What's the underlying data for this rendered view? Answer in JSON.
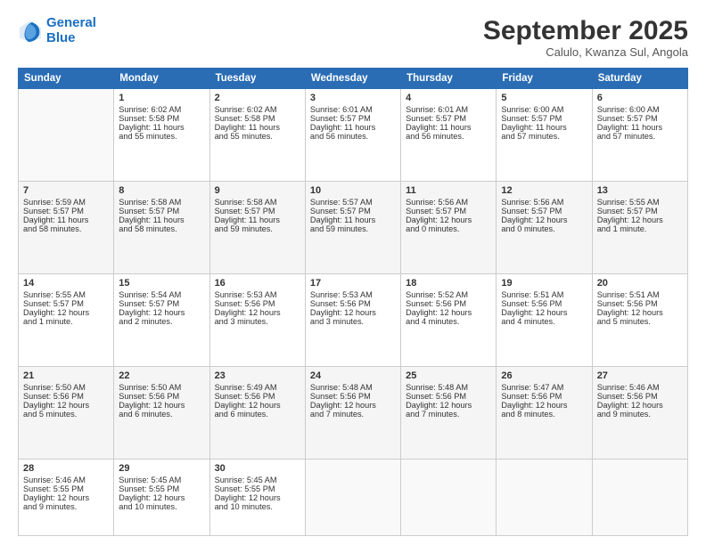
{
  "logo": {
    "line1": "General",
    "line2": "Blue"
  },
  "title": "September 2025",
  "subtitle": "Calulo, Kwanza Sul, Angola",
  "days": [
    "Sunday",
    "Monday",
    "Tuesday",
    "Wednesday",
    "Thursday",
    "Friday",
    "Saturday"
  ],
  "weeks": [
    [
      {
        "num": "",
        "content": ""
      },
      {
        "num": "1",
        "content": "Sunrise: 6:02 AM\nSunset: 5:58 PM\nDaylight: 11 hours\nand 55 minutes."
      },
      {
        "num": "2",
        "content": "Sunrise: 6:02 AM\nSunset: 5:58 PM\nDaylight: 11 hours\nand 55 minutes."
      },
      {
        "num": "3",
        "content": "Sunrise: 6:01 AM\nSunset: 5:57 PM\nDaylight: 11 hours\nand 56 minutes."
      },
      {
        "num": "4",
        "content": "Sunrise: 6:01 AM\nSunset: 5:57 PM\nDaylight: 11 hours\nand 56 minutes."
      },
      {
        "num": "5",
        "content": "Sunrise: 6:00 AM\nSunset: 5:57 PM\nDaylight: 11 hours\nand 57 minutes."
      },
      {
        "num": "6",
        "content": "Sunrise: 6:00 AM\nSunset: 5:57 PM\nDaylight: 11 hours\nand 57 minutes."
      }
    ],
    [
      {
        "num": "7",
        "content": "Sunrise: 5:59 AM\nSunset: 5:57 PM\nDaylight: 11 hours\nand 58 minutes."
      },
      {
        "num": "8",
        "content": "Sunrise: 5:58 AM\nSunset: 5:57 PM\nDaylight: 11 hours\nand 58 minutes."
      },
      {
        "num": "9",
        "content": "Sunrise: 5:58 AM\nSunset: 5:57 PM\nDaylight: 11 hours\nand 59 minutes."
      },
      {
        "num": "10",
        "content": "Sunrise: 5:57 AM\nSunset: 5:57 PM\nDaylight: 11 hours\nand 59 minutes."
      },
      {
        "num": "11",
        "content": "Sunrise: 5:56 AM\nSunset: 5:57 PM\nDaylight: 12 hours\nand 0 minutes."
      },
      {
        "num": "12",
        "content": "Sunrise: 5:56 AM\nSunset: 5:57 PM\nDaylight: 12 hours\nand 0 minutes."
      },
      {
        "num": "13",
        "content": "Sunrise: 5:55 AM\nSunset: 5:57 PM\nDaylight: 12 hours\nand 1 minute."
      }
    ],
    [
      {
        "num": "14",
        "content": "Sunrise: 5:55 AM\nSunset: 5:57 PM\nDaylight: 12 hours\nand 1 minute."
      },
      {
        "num": "15",
        "content": "Sunrise: 5:54 AM\nSunset: 5:57 PM\nDaylight: 12 hours\nand 2 minutes."
      },
      {
        "num": "16",
        "content": "Sunrise: 5:53 AM\nSunset: 5:56 PM\nDaylight: 12 hours\nand 3 minutes."
      },
      {
        "num": "17",
        "content": "Sunrise: 5:53 AM\nSunset: 5:56 PM\nDaylight: 12 hours\nand 3 minutes."
      },
      {
        "num": "18",
        "content": "Sunrise: 5:52 AM\nSunset: 5:56 PM\nDaylight: 12 hours\nand 4 minutes."
      },
      {
        "num": "19",
        "content": "Sunrise: 5:51 AM\nSunset: 5:56 PM\nDaylight: 12 hours\nand 4 minutes."
      },
      {
        "num": "20",
        "content": "Sunrise: 5:51 AM\nSunset: 5:56 PM\nDaylight: 12 hours\nand 5 minutes."
      }
    ],
    [
      {
        "num": "21",
        "content": "Sunrise: 5:50 AM\nSunset: 5:56 PM\nDaylight: 12 hours\nand 5 minutes."
      },
      {
        "num": "22",
        "content": "Sunrise: 5:50 AM\nSunset: 5:56 PM\nDaylight: 12 hours\nand 6 minutes."
      },
      {
        "num": "23",
        "content": "Sunrise: 5:49 AM\nSunset: 5:56 PM\nDaylight: 12 hours\nand 6 minutes."
      },
      {
        "num": "24",
        "content": "Sunrise: 5:48 AM\nSunset: 5:56 PM\nDaylight: 12 hours\nand 7 minutes."
      },
      {
        "num": "25",
        "content": "Sunrise: 5:48 AM\nSunset: 5:56 PM\nDaylight: 12 hours\nand 7 minutes."
      },
      {
        "num": "26",
        "content": "Sunrise: 5:47 AM\nSunset: 5:56 PM\nDaylight: 12 hours\nand 8 minutes."
      },
      {
        "num": "27",
        "content": "Sunrise: 5:46 AM\nSunset: 5:56 PM\nDaylight: 12 hours\nand 9 minutes."
      }
    ],
    [
      {
        "num": "28",
        "content": "Sunrise: 5:46 AM\nSunset: 5:55 PM\nDaylight: 12 hours\nand 9 minutes."
      },
      {
        "num": "29",
        "content": "Sunrise: 5:45 AM\nSunset: 5:55 PM\nDaylight: 12 hours\nand 10 minutes."
      },
      {
        "num": "30",
        "content": "Sunrise: 5:45 AM\nSunset: 5:55 PM\nDaylight: 12 hours\nand 10 minutes."
      },
      {
        "num": "",
        "content": ""
      },
      {
        "num": "",
        "content": ""
      },
      {
        "num": "",
        "content": ""
      },
      {
        "num": "",
        "content": ""
      }
    ]
  ]
}
